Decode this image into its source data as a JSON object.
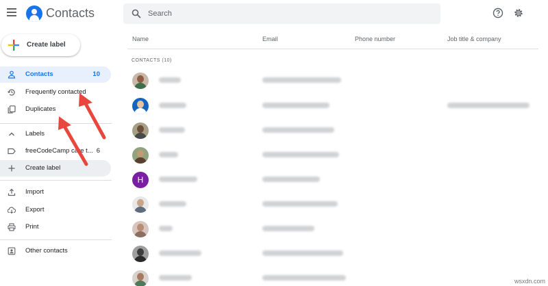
{
  "app": {
    "title": "Contacts"
  },
  "search": {
    "placeholder": "Search"
  },
  "sidebar": {
    "create_label": "Create label",
    "items": [
      {
        "label": "Contacts",
        "count": "10",
        "icon": "person-icon"
      },
      {
        "label": "Frequently contacted",
        "icon": "history-icon"
      },
      {
        "label": "Duplicates",
        "icon": "duplicate-icon"
      }
    ],
    "labels_header": "Labels",
    "label_items": [
      {
        "label": "freeCodeCamp care t...",
        "count": "6"
      }
    ],
    "actions": [
      {
        "label": "Import",
        "icon": "upload-icon"
      },
      {
        "label": "Export",
        "icon": "cloud-download-icon"
      },
      {
        "label": "Print",
        "icon": "print-icon"
      }
    ],
    "other_contacts": "Other contacts"
  },
  "table": {
    "columns": [
      "Name",
      "Email",
      "Phone number",
      "Job title & company"
    ],
    "section_label": "CONTACTS (10)",
    "rows": [
      {
        "avatar": "photo",
        "name_blurred": true,
        "email_blurred": true,
        "job_blurred": false
      },
      {
        "avatar": "photo",
        "name_blurred": true,
        "email_blurred": true,
        "job_blurred": true
      },
      {
        "avatar": "photo",
        "name_blurred": true,
        "email_blurred": true,
        "job_blurred": false
      },
      {
        "avatar": "photo",
        "name_blurred": true,
        "email_blurred": true,
        "job_blurred": false
      },
      {
        "avatar": "letter",
        "letter": "H",
        "name_blurred": true,
        "email_blurred": true,
        "job_blurred": false
      },
      {
        "avatar": "photo",
        "name_blurred": true,
        "email_blurred": true,
        "job_blurred": false
      },
      {
        "avatar": "photo",
        "name_blurred": true,
        "email_blurred": true,
        "job_blurred": false
      },
      {
        "avatar": "photo",
        "name_blurred": true,
        "email_blurred": true,
        "job_blurred": false
      },
      {
        "avatar": "photo",
        "name_blurred": true,
        "email_blurred": true,
        "job_blurred": false
      }
    ]
  },
  "colors": {
    "accent": "#1a73e8",
    "active_bg": "#e8f0fe",
    "avatar_h": "#7b1fa2",
    "arrow": "#e8473d"
  },
  "watermark": "wsxdn.com"
}
